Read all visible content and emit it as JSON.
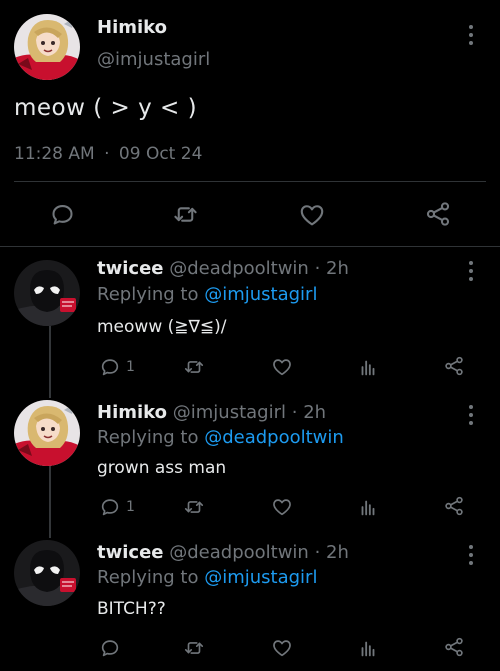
{
  "main": {
    "name": "Himiko",
    "handle": "@imjustagirl",
    "text": "meow  ( > y < )",
    "time": "11:28 AM",
    "dot": "·",
    "date": "09 Oct 24"
  },
  "replies": [
    {
      "name": "twicee",
      "handle": "@deadpooltwin",
      "dot": "·",
      "age": "2h",
      "replying_label": "Replying to",
      "replying_to": "@imjustagirl",
      "text": "meoww (≧∇≦)/",
      "reply_count": "1"
    },
    {
      "name": "Himiko",
      "handle": "@imjustagirl",
      "dot": "·",
      "age": "2h",
      "replying_label": "Replying to",
      "replying_to": "@deadpooltwin",
      "text": "grown ass man",
      "reply_count": "1"
    },
    {
      "name": "twicee",
      "handle": "@deadpooltwin",
      "dot": "·",
      "age": "2h",
      "replying_label": "Replying to",
      "replying_to": "@imjustagirl",
      "text": "BITCH??",
      "reply_count": ""
    }
  ],
  "icons": {
    "reply": "reply-icon",
    "retweet": "retweet-icon",
    "like": "heart-icon",
    "stats": "stats-icon",
    "share": "share-icon",
    "more": "more-icon"
  },
  "colors": {
    "background": "#000000",
    "text": "#e7e9ea",
    "muted": "#71767b",
    "link": "#1d9bf0",
    "avatar_red": "#c8102e"
  }
}
